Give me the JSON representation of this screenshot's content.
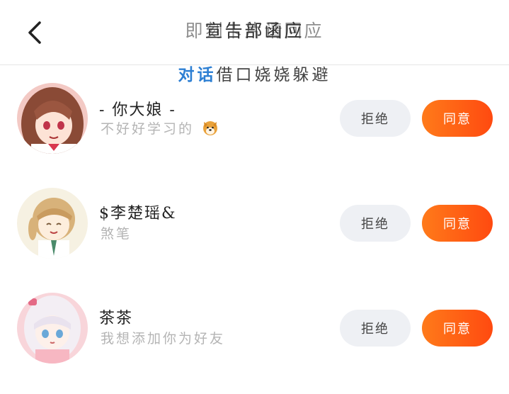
{
  "header": {
    "title": "宣告部函应",
    "title_overlay": "即刻卡片请回应",
    "subtitle_accent": "对话",
    "subtitle_rest": "借口娆娆躲避"
  },
  "buttons": {
    "reject_label": "拒绝",
    "accept_label": "同意"
  },
  "requests": [
    {
      "name": "- 你大娘 -",
      "message": "不好好学习的",
      "emoji": "dog-face-emoji"
    },
    {
      "name": "$李楚瑶&",
      "message": "煞笔"
    },
    {
      "name": "茶茶",
      "message": "我想添加你为好友"
    }
  ],
  "colors": {
    "accent": "#ff5a12",
    "reject_bg": "#eef0f4",
    "title_accent": "#2d7fd3"
  }
}
